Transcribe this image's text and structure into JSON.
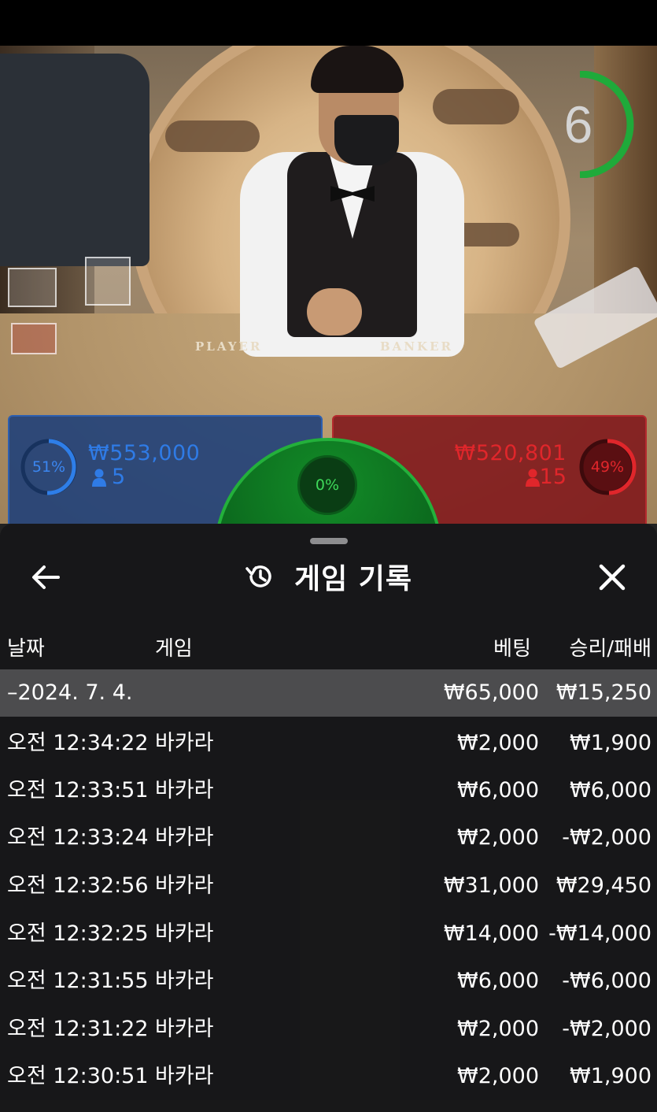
{
  "video": {
    "table_labels": [
      "PLAYER",
      "BANKER"
    ],
    "countdown": "6"
  },
  "bets": {
    "player": {
      "percent": "51%",
      "amount": "₩553,000",
      "players": "5",
      "color": "#2e6fd8"
    },
    "banker": {
      "percent": "49%",
      "amount": "₩520,801",
      "players": "15",
      "color": "#e0262b"
    },
    "tie": {
      "percent": "0%",
      "color": "#23b03b"
    }
  },
  "panel": {
    "title": "게임 기록",
    "back_icon": "arrow-left-icon",
    "history_icon": "history-icon",
    "close_icon": "close-icon",
    "columns": {
      "date": "날짜",
      "game": "게임",
      "bet": "베팅",
      "win_loss": "승리/패배"
    },
    "summary": {
      "date": "–2024. 7. 4.",
      "bet": "₩65,000",
      "win_loss": "₩15,250"
    },
    "rows": [
      {
        "time": "오전 12:34:22",
        "game": "바카라",
        "bet": "₩2,000",
        "win_loss": "₩1,900"
      },
      {
        "time": "오전 12:33:51",
        "game": "바카라",
        "bet": "₩6,000",
        "win_loss": "₩6,000"
      },
      {
        "time": "오전 12:33:24",
        "game": "바카라",
        "bet": "₩2,000",
        "win_loss": "-₩2,000"
      },
      {
        "time": "오전 12:32:56",
        "game": "바카라",
        "bet": "₩31,000",
        "win_loss": "₩29,450"
      },
      {
        "time": "오전 12:32:25",
        "game": "바카라",
        "bet": "₩14,000",
        "win_loss": "-₩14,000"
      },
      {
        "time": "오전 12:31:55",
        "game": "바카라",
        "bet": "₩6,000",
        "win_loss": "-₩6,000"
      },
      {
        "time": "오전 12:31:22",
        "game": "바카라",
        "bet": "₩2,000",
        "win_loss": "-₩2,000"
      },
      {
        "time": "오전 12:30:51",
        "game": "바카라",
        "bet": "₩2,000",
        "win_loss": "₩1,900"
      }
    ]
  }
}
